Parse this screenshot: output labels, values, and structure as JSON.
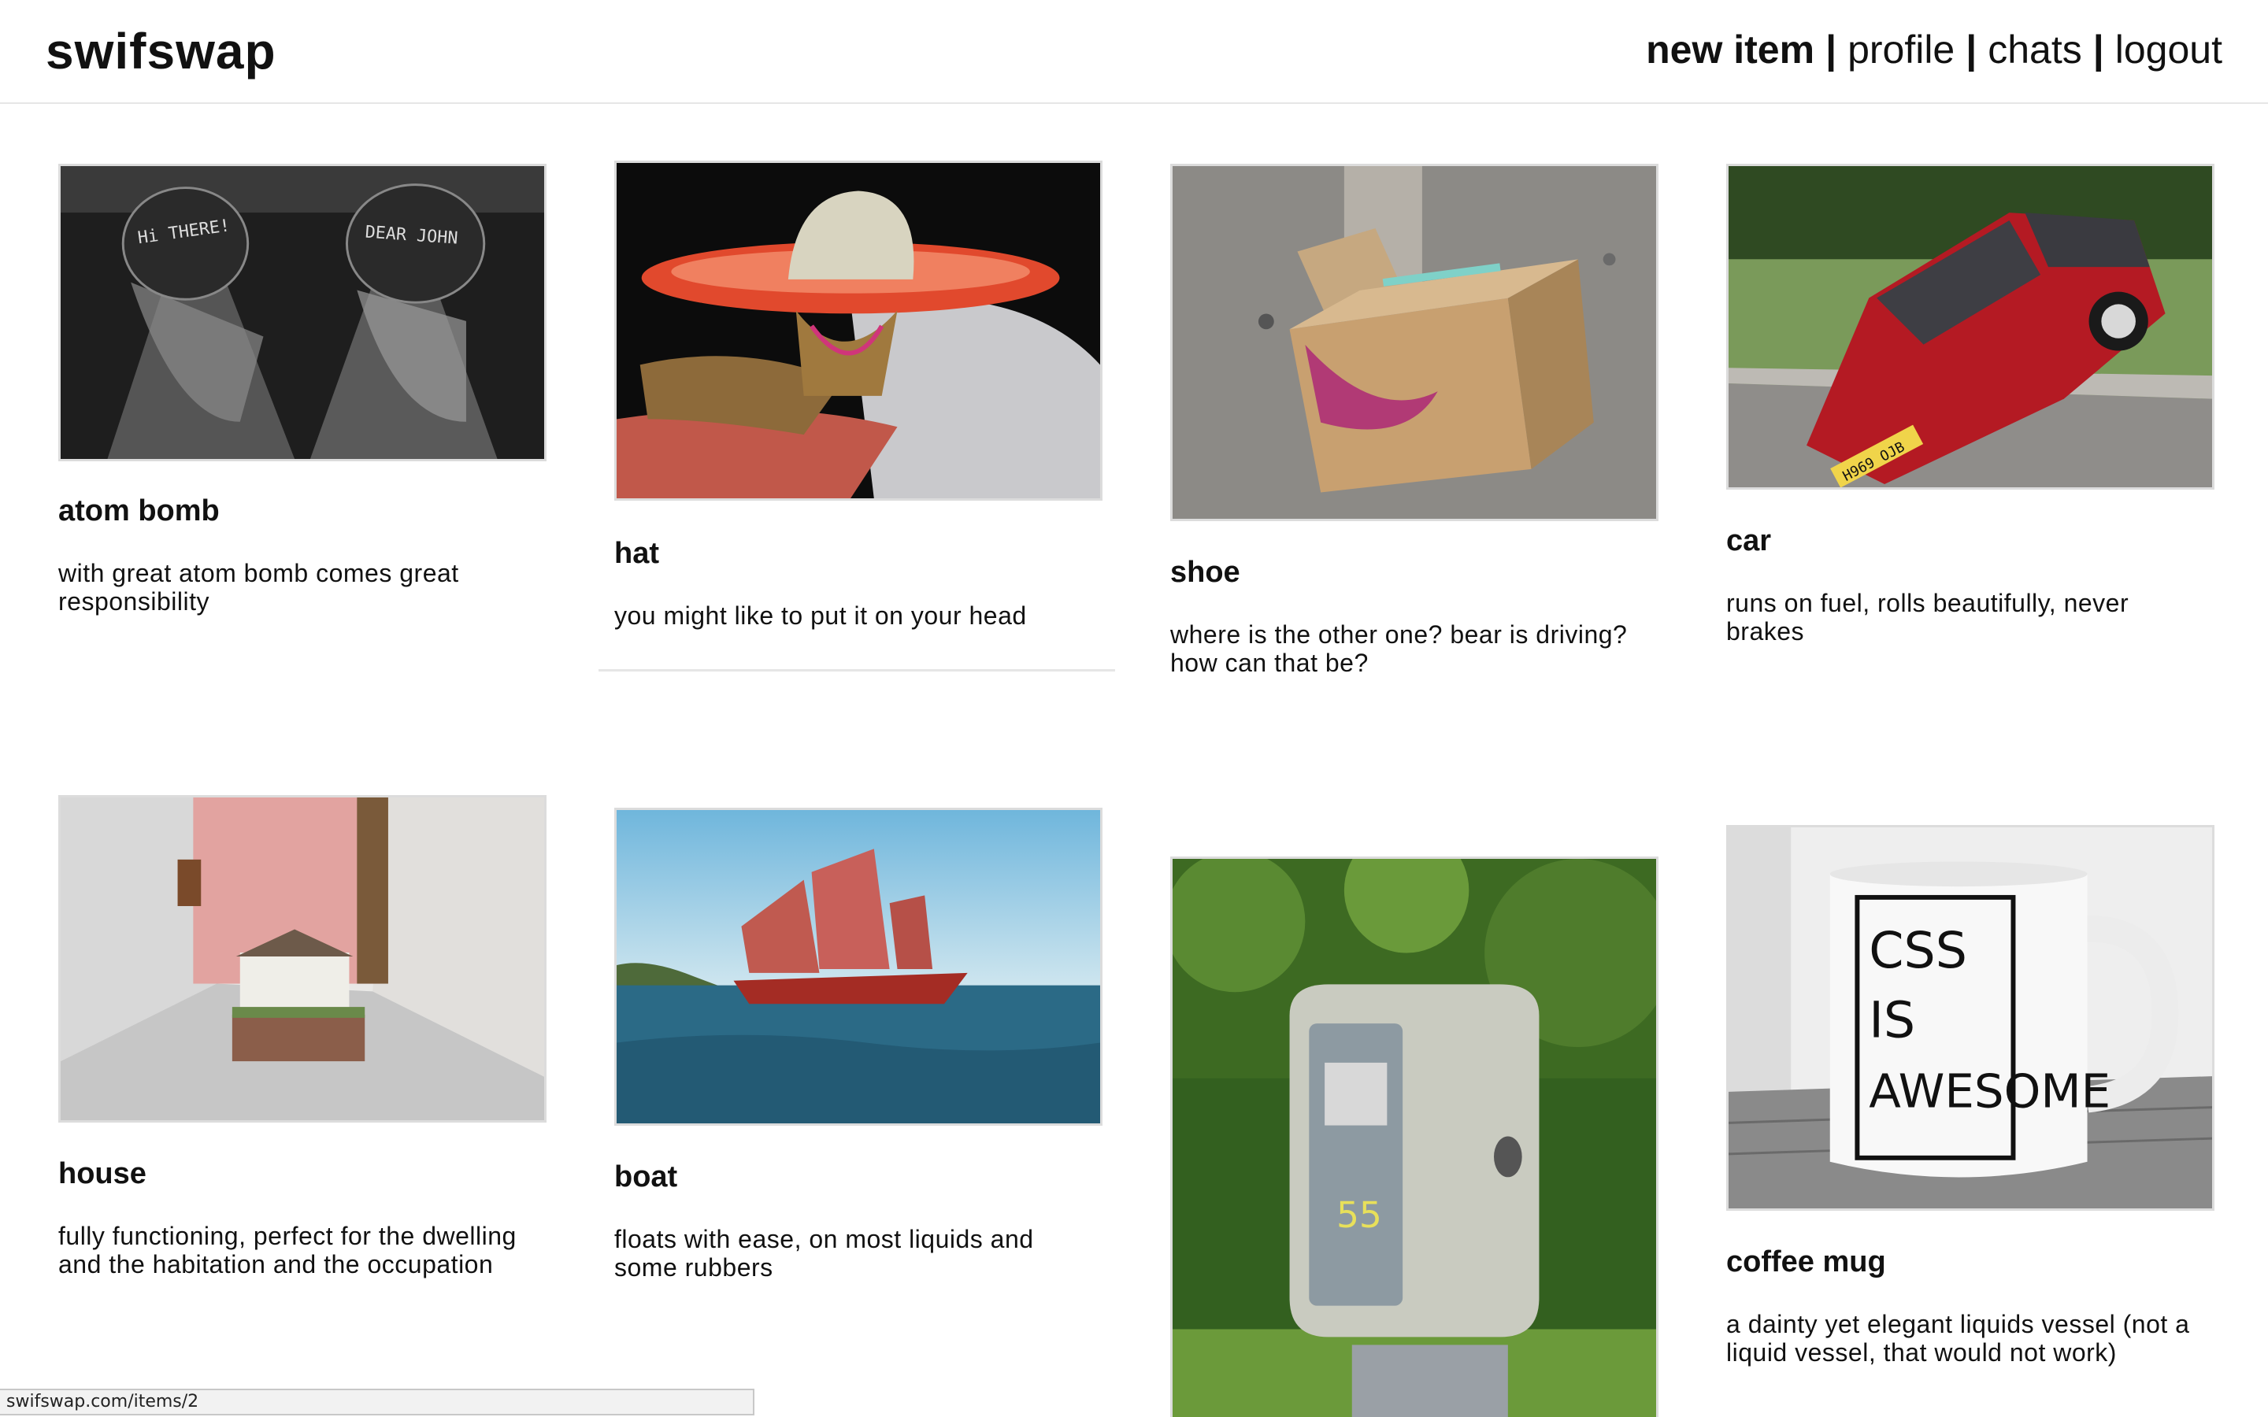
{
  "app": {
    "logo": "swifswap"
  },
  "nav": {
    "new_item": "new item",
    "profile": "profile",
    "chats": "chats",
    "logout": "logout",
    "separator": "|"
  },
  "items": [
    {
      "title": "atom bomb",
      "description": "with great atom bomb comes great responsibility"
    },
    {
      "title": "hat",
      "description": "you might like to put it on your head"
    },
    {
      "title": "shoe",
      "description": "where is the other one? bear is driving? how can that be?"
    },
    {
      "title": "car",
      "description": "runs on fuel, rolls beautifully, never brakes"
    },
    {
      "title": "house",
      "description": "fully functioning, perfect for the dwelling and the habitation and the occupation"
    },
    {
      "title": "boat",
      "description": "floats with ease, on most liquids and some rubbers"
    },
    {
      "title": "",
      "description": ""
    },
    {
      "title": "coffee mug",
      "description": "a dainty yet elegant liquids vessel (not a liquid vessel, that would not work)"
    }
  ],
  "image_text": {
    "bomb_left": "Hi THERE!",
    "bomb_right": "DEAR JOHN",
    "car_plate": "H969 OJB",
    "mac_number": "55",
    "mug_line1": "CSS",
    "mug_line2": "IS",
    "mug_line3": "AWESOME"
  },
  "status_bar": {
    "url": "swifswap.com/items/2"
  }
}
